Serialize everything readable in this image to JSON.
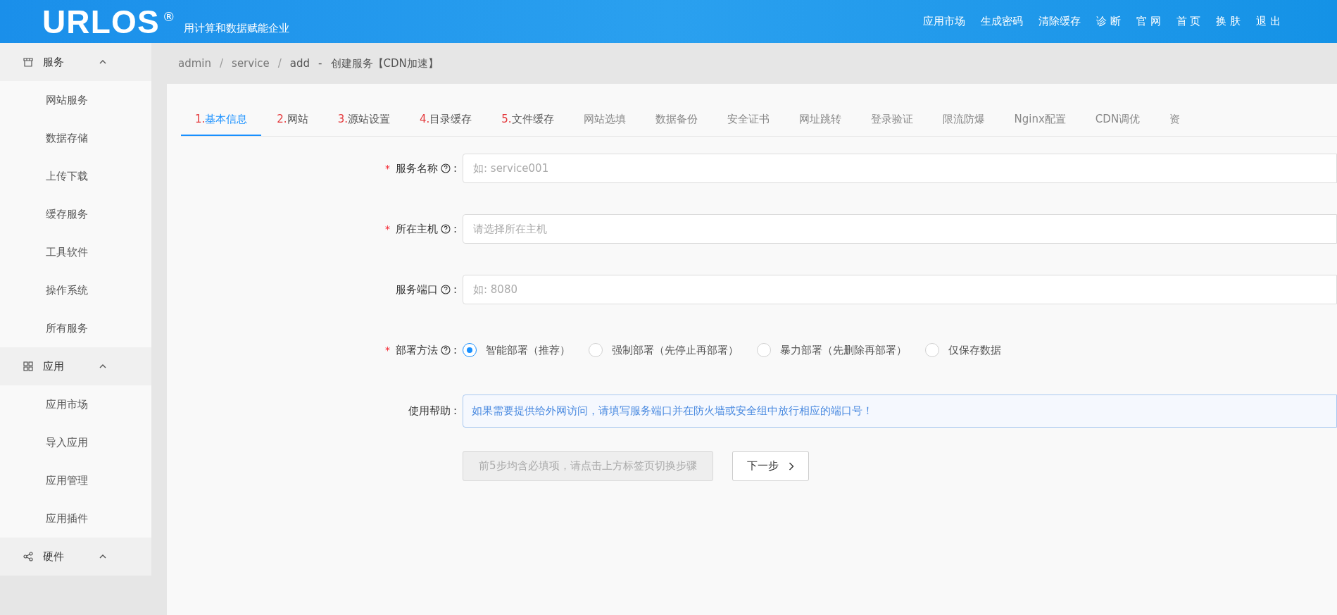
{
  "header": {
    "logo": "URLOS",
    "logo_mark": "®",
    "slogan": "用计算和数据赋能企业",
    "nav": [
      "应用市场",
      "生成密码",
      "清除缓存",
      "诊 断",
      "官 网",
      "首 页",
      "换 肤",
      "退 出"
    ]
  },
  "sidebar": {
    "groups": [
      {
        "title": "服务",
        "expanded": true,
        "items": [
          "网站服务",
          "数据存储",
          "上传下载",
          "缓存服务",
          "工具软件",
          "操作系统",
          "所有服务"
        ]
      },
      {
        "title": "应用",
        "expanded": true,
        "items": [
          "应用市场",
          "导入应用",
          "应用管理",
          "应用插件"
        ]
      },
      {
        "title": "硬件",
        "expanded": true
      }
    ]
  },
  "breadcrumb": {
    "items": [
      "admin",
      "service"
    ],
    "separator": "/",
    "current": "add",
    "dash": "-",
    "title": "创建服务【CDN加速】"
  },
  "tabs": [
    {
      "step": "1.",
      "label": "基本信息",
      "selected": true
    },
    {
      "step": "2.",
      "label": "网站",
      "selected": false
    },
    {
      "step": "3.",
      "label": "源站设置",
      "selected": false
    },
    {
      "step": "4.",
      "label": "目录缓存",
      "selected": false
    },
    {
      "step": "5.",
      "label": "文件缓存",
      "selected": false
    },
    {
      "label": "网站选填",
      "selected": false
    },
    {
      "label": "数据备份",
      "selected": false
    },
    {
      "label": "安全证书",
      "selected": false
    },
    {
      "label": "网址跳转",
      "selected": false
    },
    {
      "label": "登录验证",
      "selected": false
    },
    {
      "label": "限流防爆",
      "selected": false
    },
    {
      "label": "Nginx配置",
      "selected": false
    },
    {
      "label": "CDN调优",
      "selected": false
    },
    {
      "label": "资",
      "selected": false
    }
  ],
  "form": {
    "required_mark": "*",
    "colon": ":",
    "fields": [
      {
        "kind": "input",
        "label": "服务名称",
        "required": true,
        "help": true,
        "placeholder": "如: service001"
      },
      {
        "kind": "input",
        "label": "所在主机",
        "required": true,
        "help": true,
        "placeholder": "请选择所在主机"
      },
      {
        "kind": "input",
        "label": "服务端口",
        "required": false,
        "help": true,
        "placeholder": "如: 8080"
      },
      {
        "kind": "radio",
        "label": "部署方法",
        "required": true,
        "help": true,
        "options": [
          {
            "label": "智能部署（推荐）",
            "selected": true
          },
          {
            "label": "强制部署（先停止再部署）",
            "selected": false
          },
          {
            "label": "暴力部署（先删除再部署）",
            "selected": false
          },
          {
            "label": "仅保存数据",
            "selected": false
          }
        ]
      },
      {
        "kind": "note",
        "label": "使用帮助",
        "required": false,
        "help": false,
        "text": "如果需要提供给外网访问，请填写服务端口并在防火墙或安全组中放行相应的端口号！"
      }
    ],
    "buttons": [
      {
        "label": "前5步均含必填项，请点击上方标签页切换步骤",
        "disabled": true
      },
      {
        "label": "下一步",
        "disabled": false
      }
    ]
  }
}
